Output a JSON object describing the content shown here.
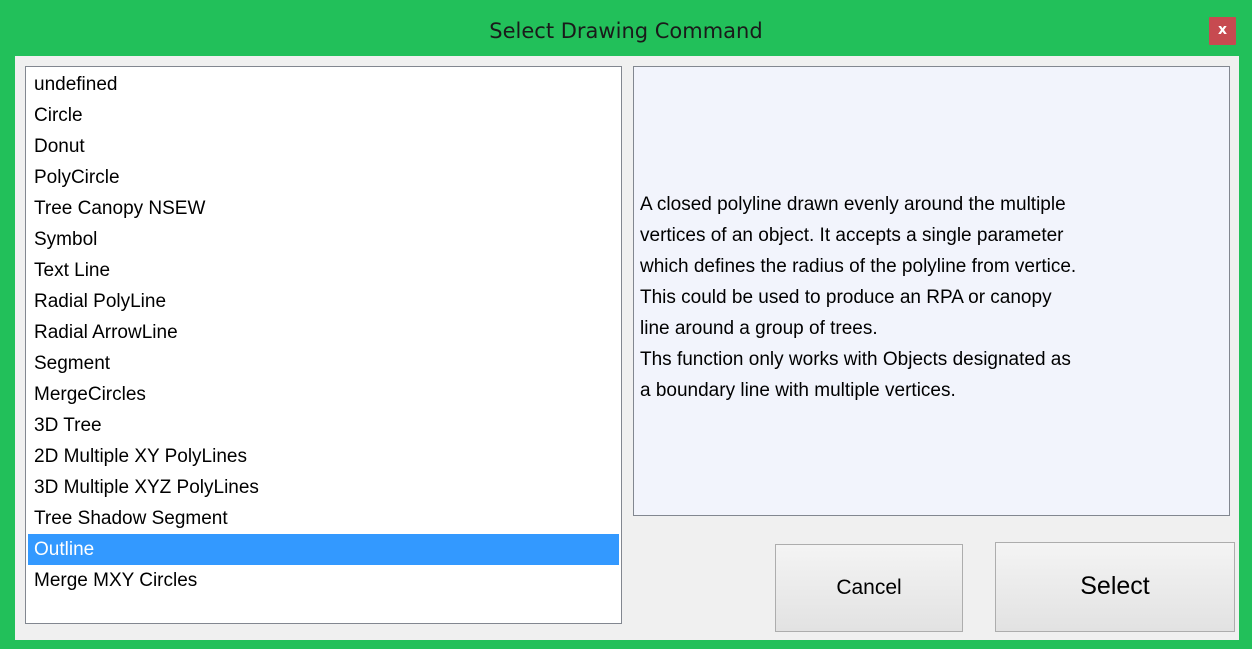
{
  "window": {
    "title": "Select Drawing Command",
    "close_label": "x"
  },
  "command_list": {
    "items": [
      {
        "label": "undefined"
      },
      {
        "label": "Circle"
      },
      {
        "label": "Donut"
      },
      {
        "label": "PolyCircle"
      },
      {
        "label": "Tree Canopy NSEW"
      },
      {
        "label": "Symbol"
      },
      {
        "label": "Text Line"
      },
      {
        "label": "Radial PolyLine"
      },
      {
        "label": "Radial ArrowLine"
      },
      {
        "label": "Segment"
      },
      {
        "label": "MergeCircles"
      },
      {
        "label": "3D Tree"
      },
      {
        "label": "2D Multiple XY PolyLines"
      },
      {
        "label": "3D Multiple XYZ PolyLines"
      },
      {
        "label": "Tree Shadow Segment"
      },
      {
        "label": "Outline"
      },
      {
        "label": "Merge MXY Circles"
      }
    ],
    "selected_label": "Outline"
  },
  "description": {
    "text": "A closed polyline drawn evenly around the multiple\nvertices of an object. It accepts a single parameter\nwhich defines the radius of the polyline from vertice.\nThis could be used to produce an RPA or canopy\nline around a group of trees.\nThs function only works with Objects designated as\na boundary line with multiple vertices."
  },
  "buttons": {
    "cancel_label": "Cancel",
    "select_label": "Select"
  },
  "colors": {
    "window_frame": "#22c05a",
    "close_button": "#c74a50",
    "selection": "#3399ff",
    "description_bg": "#f2f4fc"
  }
}
